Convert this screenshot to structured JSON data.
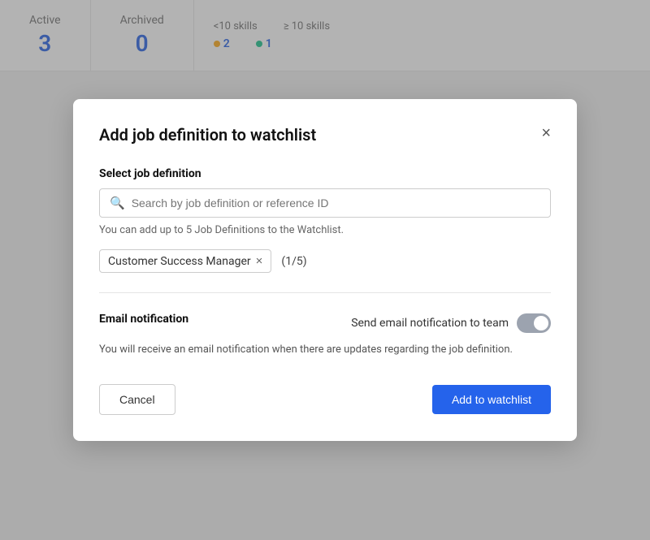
{
  "stats": {
    "active": {
      "label": "Active",
      "value": "3"
    },
    "archived": {
      "label": "Archived",
      "value": "0"
    },
    "skills": {
      "less_than_label": "<10 skills",
      "greater_equal_label": "≥ 10 skills",
      "less_count": "2",
      "greater_count": "1"
    }
  },
  "modal": {
    "title": "Add job definition to watchlist",
    "close_label": "×",
    "select_section_label": "Select job definition",
    "search_placeholder": "Search by job definition or reference ID",
    "hint": "You can add up to 5 Job Definitions to the Watchlist.",
    "selected_tag": "Customer Success Manager",
    "tag_remove": "×",
    "count": "(1/5)",
    "email_section_label": "Email notification",
    "toggle_label": "Send email notification to team",
    "email_description": "You will receive an email notification when there are updates regarding the job definition.",
    "cancel_label": "Cancel",
    "add_label": "Add to watchlist"
  }
}
